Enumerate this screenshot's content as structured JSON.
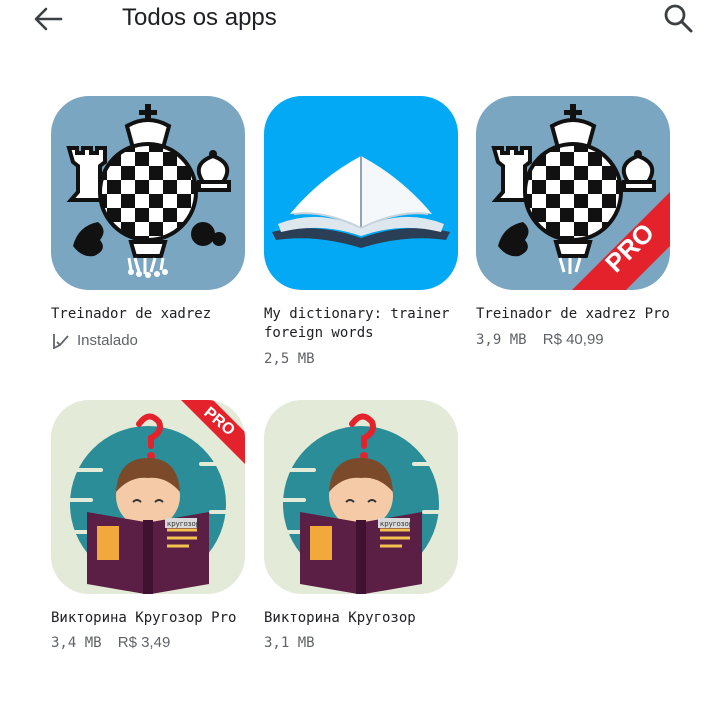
{
  "header": {
    "title": "Todos os apps",
    "back_icon": "arrow-back-icon",
    "search_icon": "search-icon"
  },
  "apps": [
    {
      "name": "Treinador de xadrez",
      "status": "Instalado",
      "icon": "chess-app-icon"
    },
    {
      "name": "My dictionary: trainer foreign words",
      "size": "2,5 MB",
      "icon": "open-book-icon"
    },
    {
      "name": "Treinador de xadrez Pro",
      "size": "3,9 MB",
      "price": "R$ 40,99",
      "icon": "chess-app-icon",
      "badge": "PRO"
    },
    {
      "name": "Викторина Кругозор Pro",
      "size": "3,4 MB",
      "price": "R$ 3,49",
      "icon": "quiz-reader-icon",
      "badge": "PRO",
      "book_label": "кругозор"
    },
    {
      "name": "Викторина Кругозор",
      "size": "3,1 MB",
      "icon": "quiz-reader-icon",
      "book_label": "кругозор"
    }
  ],
  "colors": {
    "chess_bg": "#7aa6c2",
    "dictionary_bg": "#03a9f4",
    "quiz_bg": "#e3ead7",
    "quiz_circle": "#2b8d97",
    "pro_badge": "#e3222b"
  }
}
